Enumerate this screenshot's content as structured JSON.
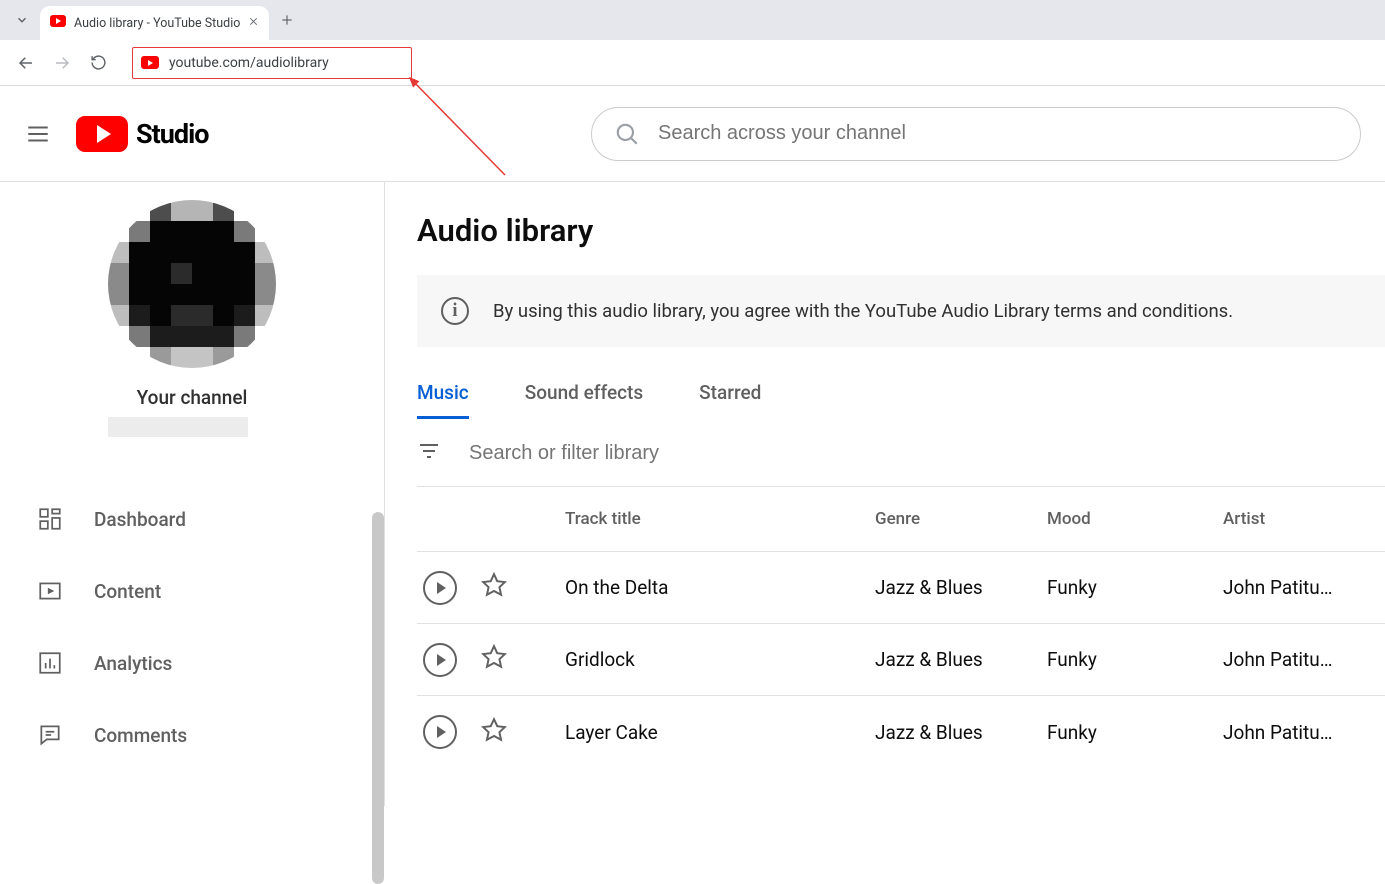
{
  "browser": {
    "tab_title": "Audio library - YouTube Studio",
    "url": "youtube.com/audiolibrary"
  },
  "header": {
    "logo_text": "Studio",
    "search_placeholder": "Search across your channel"
  },
  "sidebar": {
    "channel_label": "Your channel",
    "items": [
      {
        "label": "Dashboard",
        "icon": "dashboard"
      },
      {
        "label": "Content",
        "icon": "content"
      },
      {
        "label": "Analytics",
        "icon": "analytics"
      },
      {
        "label": "Comments",
        "icon": "comments"
      }
    ]
  },
  "main": {
    "title": "Audio library",
    "notice": "By using this audio library, you agree with the YouTube Audio Library terms and conditions.",
    "tabs": [
      {
        "label": "Music",
        "active": true
      },
      {
        "label": "Sound effects",
        "active": false
      },
      {
        "label": "Starred",
        "active": false
      }
    ],
    "filter_placeholder": "Search or filter library",
    "columns": {
      "title": "Track title",
      "genre": "Genre",
      "mood": "Mood",
      "artist": "Artist"
    },
    "tracks": [
      {
        "title": "On the Delta",
        "genre": "Jazz & Blues",
        "mood": "Funky",
        "artist": "John Patitu…"
      },
      {
        "title": "Gridlock",
        "genre": "Jazz & Blues",
        "mood": "Funky",
        "artist": "John Patitu…"
      },
      {
        "title": "Layer Cake",
        "genre": "Jazz & Blues",
        "mood": "Funky",
        "artist": "John Patitu…"
      }
    ]
  }
}
